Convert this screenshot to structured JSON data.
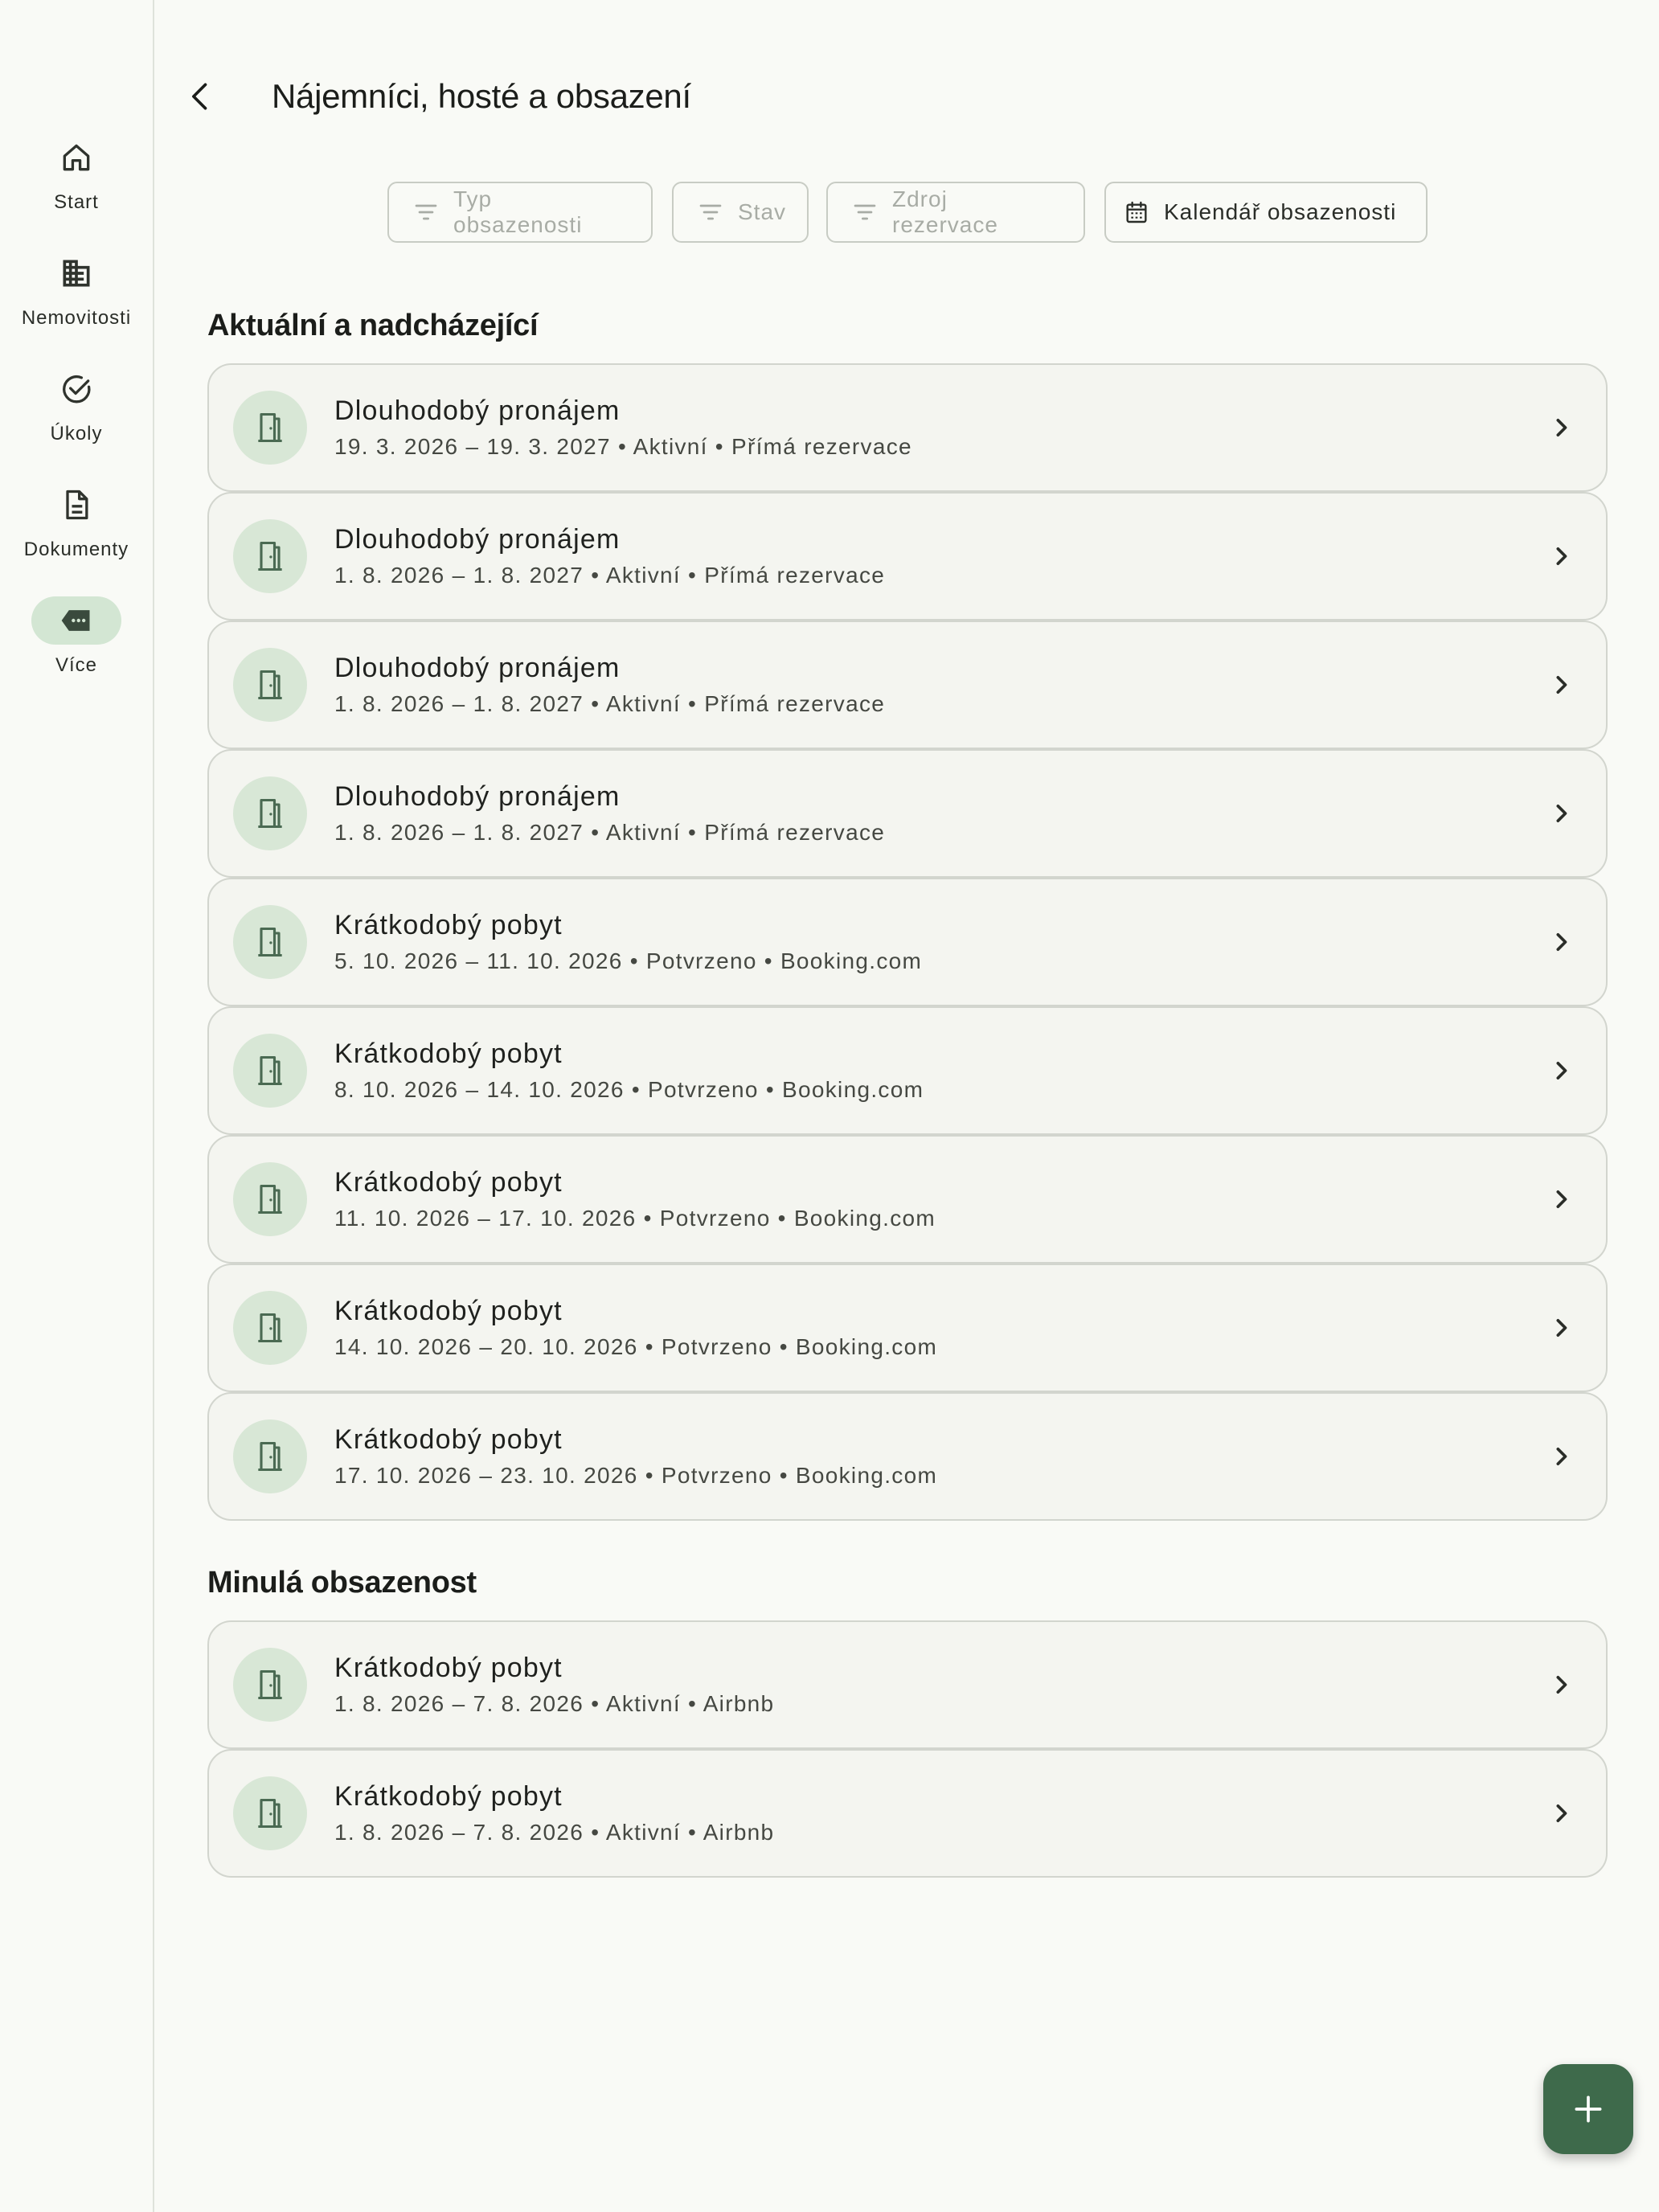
{
  "nav": {
    "items": [
      {
        "label": "Start",
        "icon": "home-icon"
      },
      {
        "label": "Nemovitosti",
        "icon": "building-icon"
      },
      {
        "label": "Úkoly",
        "icon": "check-circle-icon"
      },
      {
        "label": "Dokumenty",
        "icon": "document-icon"
      },
      {
        "label": "Více",
        "icon": "more-icon",
        "active": true
      }
    ]
  },
  "header": {
    "title": "Nájemníci, hosté a obsazení",
    "back_icon": "arrow-back-icon"
  },
  "filters": {
    "type": "Typ obsazenosti",
    "status": "Stav",
    "source": "Zdroj rezervace",
    "calendar": "Kalendář obsazenosti"
  },
  "sections": {
    "current": {
      "title": "Aktuální a nadcházející",
      "items": [
        {
          "title": "Dlouhodobý pronájem",
          "subtitle": "19. 3. 2026 – 19. 3. 2027 • Aktivní • Přímá rezervace"
        },
        {
          "title": "Dlouhodobý pronájem",
          "subtitle": "1. 8. 2026 – 1. 8. 2027 • Aktivní • Přímá rezervace"
        },
        {
          "title": "Dlouhodobý pronájem",
          "subtitle": "1. 8. 2026 – 1. 8. 2027 • Aktivní • Přímá rezervace"
        },
        {
          "title": "Dlouhodobý pronájem",
          "subtitle": "1. 8. 2026 – 1. 8. 2027 • Aktivní • Přímá rezervace"
        },
        {
          "title": "Krátkodobý pobyt",
          "subtitle": "5. 10. 2026 – 11. 10. 2026 • Potvrzeno • Booking.com"
        },
        {
          "title": "Krátkodobý pobyt",
          "subtitle": "8. 10. 2026 – 14. 10. 2026 • Potvrzeno • Booking.com"
        },
        {
          "title": "Krátkodobý pobyt",
          "subtitle": "11. 10. 2026 – 17. 10. 2026 • Potvrzeno • Booking.com"
        },
        {
          "title": "Krátkodobý pobyt",
          "subtitle": "14. 10. 2026 – 20. 10. 2026 • Potvrzeno • Booking.com"
        },
        {
          "title": "Krátkodobý pobyt",
          "subtitle": "17. 10. 2026 – 23. 10. 2026 • Potvrzeno • Booking.com"
        }
      ]
    },
    "past": {
      "title": "Minulá obsazenost",
      "items": [
        {
          "title": "Krátkodobý pobyt",
          "subtitle": "1. 8. 2026 – 7. 8. 2026 • Aktivní • Airbnb"
        },
        {
          "title": "Krátkodobý pobyt",
          "subtitle": "1. 8. 2026 – 7. 8. 2026 • Aktivní • Airbnb"
        }
      ]
    }
  },
  "fab": {
    "icon": "plus-icon"
  },
  "colors": {
    "background": "#f9faf6",
    "card": "#f4f5f0",
    "accent": "#3e6a4b",
    "avatar": "#d8e7d6",
    "rail_active": "#d3e6d3"
  }
}
